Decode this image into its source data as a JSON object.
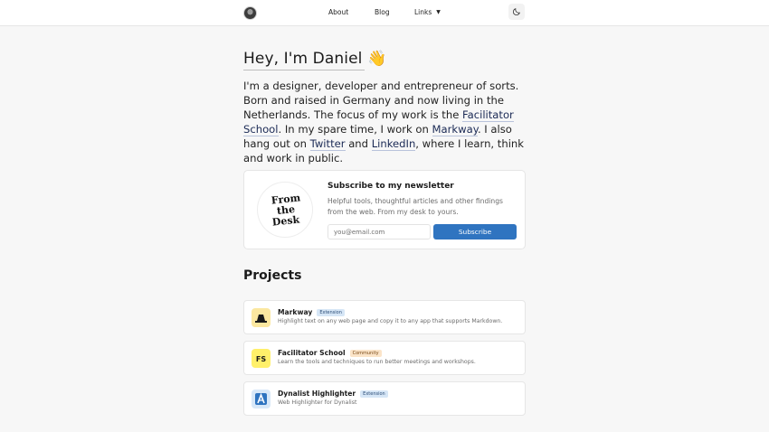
{
  "header": {
    "nav": {
      "about": "About",
      "blog": "Blog",
      "links": "Links"
    }
  },
  "hero": {
    "title": "Hey, I'm Daniel 👋",
    "intro": {
      "part1": "I'm a designer, developer and entrepreneur of sorts. Born and raised in Germany and now living in the Netherlands. The focus of my work is the ",
      "link_facilitator": "Facilitator School",
      "part2": ". In my spare time, I work on ",
      "link_markway": "Markway",
      "part3": ". I also hang out on ",
      "link_twitter": "Twitter",
      "part4": " and ",
      "link_linkedin": "LinkedIn",
      "part5": ", where I learn, think and work in public."
    }
  },
  "newsletter": {
    "logo_line1": "From",
    "logo_line2": "the",
    "logo_line3": "Desk",
    "title": "Subscribe to my newsletter",
    "text": "Helpful tools, thoughtful articles and other findings from the web. From my desk to yours.",
    "input_placeholder": "you@email.com",
    "button_label": "Subscribe"
  },
  "projects": {
    "title": "Projects",
    "items": [
      {
        "name": "Markway",
        "badge": "Extension",
        "desc": "Highlight text on any web page and copy it to any app that supports Markdown.",
        "icon": "markway-icon",
        "icon_bg": "#fbe7a0"
      },
      {
        "name": "Facilitator School",
        "badge": "Community",
        "desc": "Learn the tools and techniques to run better meetings and workshops.",
        "icon": "facilitator-school-icon",
        "icon_bg": "#fff06a"
      },
      {
        "name": "Dynalist Highlighter",
        "badge": "Extension",
        "desc": "Web Highlighter for Dynalist",
        "icon": "dynalist-icon",
        "icon_bg": "#d8e8f8"
      }
    ]
  },
  "colors": {
    "accent": "#2f74c0",
    "background": "#f7f7f7",
    "link": "#1b2a55"
  }
}
